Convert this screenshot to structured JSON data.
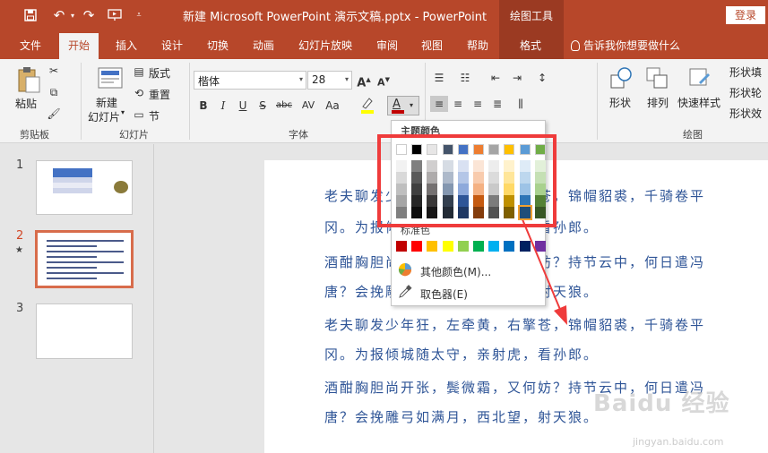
{
  "titlebar": {
    "doc_title": "新建 Microsoft PowerPoint 演示文稿.pptx - PowerPoint",
    "context_title": "绘图工具",
    "login": "登录"
  },
  "tabs": [
    {
      "label": "文件"
    },
    {
      "label": "开始"
    },
    {
      "label": "插入"
    },
    {
      "label": "设计"
    },
    {
      "label": "切换"
    },
    {
      "label": "动画"
    },
    {
      "label": "幻灯片放映"
    },
    {
      "label": "审阅"
    },
    {
      "label": "视图"
    },
    {
      "label": "帮助"
    },
    {
      "label": "格式"
    }
  ],
  "tell_me": "告诉我你想要做什么",
  "ribbon": {
    "groups": {
      "clipboard": "剪贴板",
      "slides": "幻灯片",
      "font": "字体",
      "drawing": "绘图"
    },
    "paste": "粘贴",
    "new_slide": "新建",
    "new_slide2": "幻灯片",
    "layout": "版式",
    "reset": "重置",
    "section": "节",
    "font_name": "楷体",
    "font_size": "28",
    "shape": "形状",
    "arrange": "排列",
    "quick_styles": "快速样式",
    "shape_fill": "形状填",
    "shape_outline": "形状轮",
    "shape_effect": "形状效"
  },
  "thumbs": [
    {
      "num": "1"
    },
    {
      "num": "2",
      "star": "★"
    },
    {
      "num": "3"
    }
  ],
  "poem": [
    "老夫聊发少年狂，左牵黄，右擎苍，锦帽貂裘，千骑卷平",
    "冈。为报倾城随太守，亲射虎，看孙郎。",
    "酒酣胸胆尚开张，鬓微霜，又何妨？持节云中，何日遣冯",
    "唐？会挽雕弓如满月，西北望，射天狼。",
    "老夫聊发少年狂，左牵黄，右擎苍，锦帽貂裘，千骑卷平",
    "冈。为报倾城随太守，亲射虎，看孙郎。",
    "酒酣胸胆尚开张，鬓微霜，又何妨？持节云中，何日遣冯",
    "唐？会挽雕弓如满月，西北望，射天狼。"
  ],
  "dropdown": {
    "theme_colors": "主题颜色",
    "standard_colors": "标准色",
    "more_colors": "其他颜色(M)...",
    "eyedropper": "取色器(E)",
    "theme_top": [
      "#ffffff",
      "#000000",
      "#e7e6e6",
      "#44546a",
      "#4472c4",
      "#ed7d31",
      "#a5a5a5",
      "#ffc000",
      "#5b9bd5",
      "#70ad47"
    ],
    "theme_shades": [
      [
        "#f2f2f2",
        "#d9d9d9",
        "#bfbfbf",
        "#a6a6a6",
        "#7f7f7f"
      ],
      [
        "#7f7f7f",
        "#595959",
        "#3f3f3f",
        "#262626",
        "#0d0d0d"
      ],
      [
        "#d0cece",
        "#aeabab",
        "#757171",
        "#3a3838",
        "#171616"
      ],
      [
        "#d6dce4",
        "#adb9ca",
        "#8497b0",
        "#333f4f",
        "#222a35"
      ],
      [
        "#d9e1f2",
        "#b4c6e7",
        "#8ea9db",
        "#2f5597",
        "#1f3864"
      ],
      [
        "#fbe5d6",
        "#f8cbad",
        "#f4b183",
        "#c55a11",
        "#843c0c"
      ],
      [
        "#ededed",
        "#dbdbdb",
        "#c9c9c9",
        "#7b7b7b",
        "#525252"
      ],
      [
        "#fff2cc",
        "#ffe699",
        "#ffd966",
        "#bf9000",
        "#7f6000"
      ],
      [
        "#deebf7",
        "#bdd7ee",
        "#9dc3e6",
        "#2e75b6",
        "#1f4e79"
      ],
      [
        "#e2f0d9",
        "#c5e0b4",
        "#a9d18e",
        "#548235",
        "#375623"
      ]
    ],
    "standard": [
      "#c00000",
      "#ff0000",
      "#ffc000",
      "#ffff00",
      "#92d050",
      "#00b050",
      "#00b0f0",
      "#0070c0",
      "#002060",
      "#7030a0"
    ]
  },
  "watermark": "Baidu 经验",
  "watermark_sub": "jingyan.baidu.com"
}
